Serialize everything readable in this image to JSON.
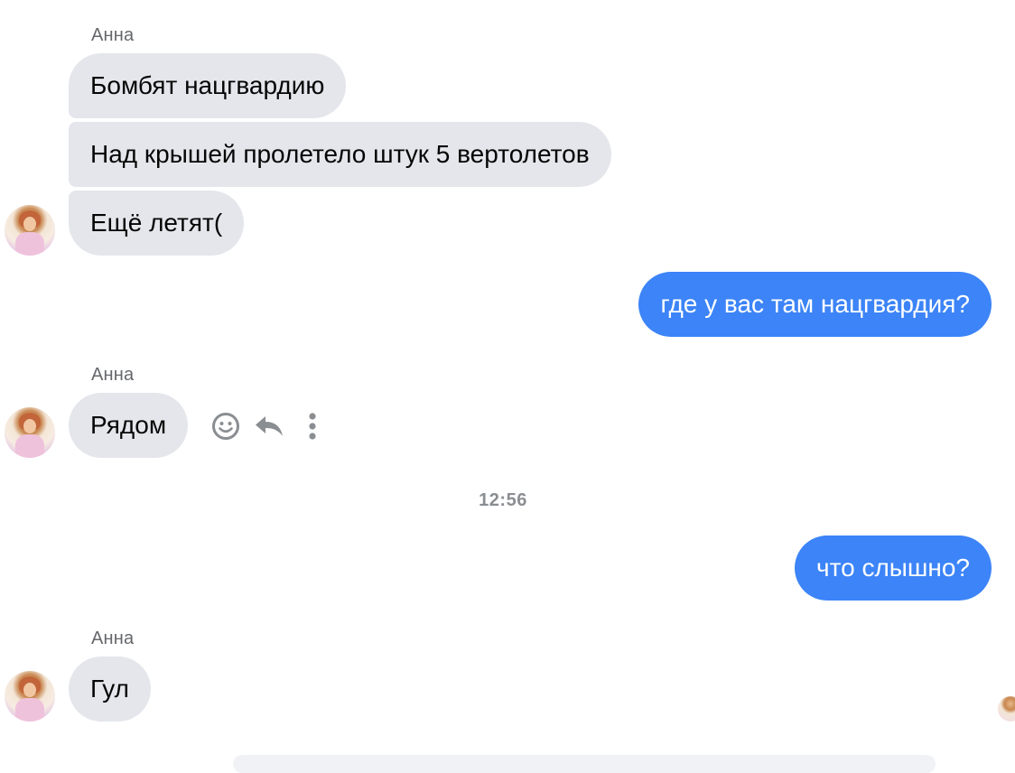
{
  "messages": [
    {
      "sender": "Анна"
    },
    {
      "text": "Бомбят нацгвардию"
    },
    {
      "text": "Над крышей пролетело штук 5 вертолетов"
    },
    {
      "text": "Ещё летят("
    },
    {
      "text": "где у вас там нацгвардия?"
    },
    {
      "sender": "Анна"
    },
    {
      "text": "Рядом"
    },
    {
      "timestamp": "12:56"
    },
    {
      "text": "что слышно?"
    },
    {
      "sender": "Анна"
    },
    {
      "text": "Гул"
    }
  ],
  "icons": {
    "react": "smiley-icon",
    "reply": "reply-icon",
    "more": "more-vertical-icon"
  },
  "colors": {
    "incoming_bubble": "#e4e6eb",
    "outgoing_bubble": "#3c84f7",
    "meta_text": "#8a8d91"
  }
}
